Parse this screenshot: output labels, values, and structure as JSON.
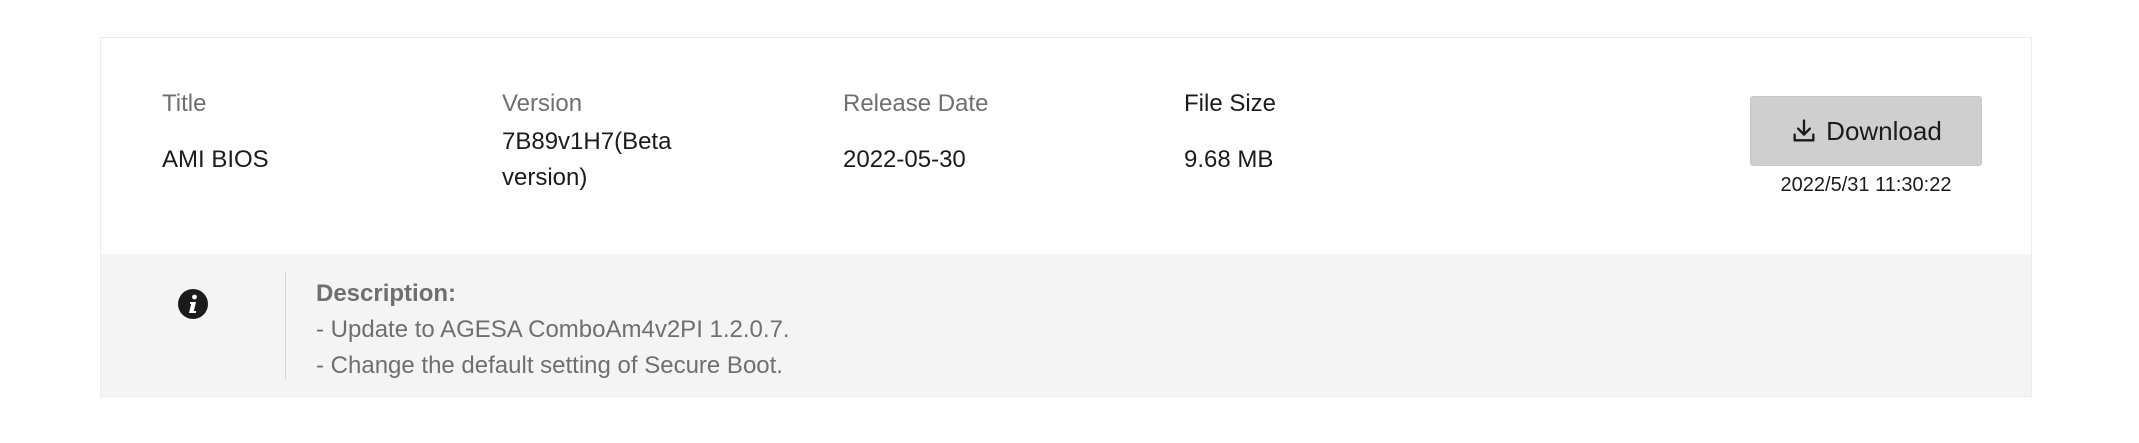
{
  "columns": {
    "title_label": "Title",
    "version_label": "Version",
    "date_label": "Release Date",
    "size_label": "File Size"
  },
  "item": {
    "title": "AMI BIOS",
    "version": "7B89v1H7(Beta version)",
    "release_date": "2022-05-30",
    "file_size": "9.68 MB"
  },
  "download": {
    "label": "Download",
    "icon": "download-icon",
    "timestamp": "2022/5/31 11:30:22"
  },
  "description": {
    "icon": "info-icon",
    "heading": "Description:",
    "lines": [
      "- Update to AGESA ComboAm4v2PI 1.2.0.7.",
      "- Change the default setting of Secure Boot."
    ]
  },
  "colors": {
    "button_bg": "#cfcfcf",
    "description_bg": "#f4f4f4",
    "label_text": "#6f6f6f"
  }
}
